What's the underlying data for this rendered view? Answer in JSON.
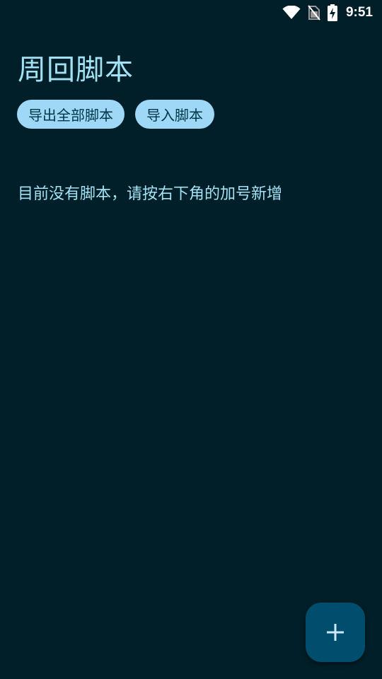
{
  "status_bar": {
    "time": "9:51",
    "icons": [
      "wifi-icon",
      "no-sim-icon",
      "battery-charging-icon"
    ]
  },
  "page": {
    "title": "周回脚本"
  },
  "actions": {
    "export_all_label": "导出全部脚本",
    "import_label": "导入脚本"
  },
  "empty_state": {
    "message": "目前没有脚本，请按右下角的加号新增"
  },
  "fab": {
    "icon": "plus-icon"
  },
  "colors": {
    "background": "#001F28",
    "text_primary": "#A3E2F4",
    "chip_bg": "#9ED8F6",
    "chip_text": "#003547",
    "fab_bg": "#004D6E",
    "fab_icon": "#CBE9F8"
  }
}
